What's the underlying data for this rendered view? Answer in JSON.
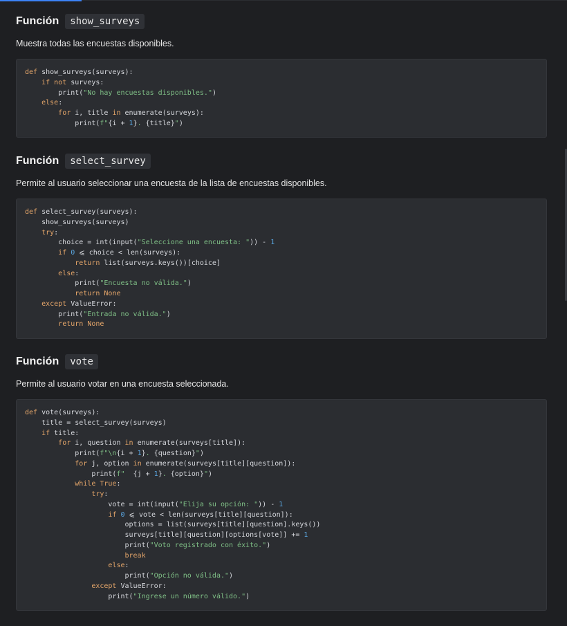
{
  "sections": [
    {
      "heading_prefix": "Función",
      "function_name": "show_surveys",
      "description": "Muestra todas las encuestas disponibles.",
      "code": [
        [
          [
            "def",
            "kw"
          ],
          [
            " show_surveys(surveys):",
            ""
          ]
        ],
        [
          [
            "    ",
            ""
          ],
          [
            "if not",
            "kw"
          ],
          [
            " surveys:",
            ""
          ]
        ],
        [
          [
            "        print(",
            ""
          ],
          [
            "\"No hay encuestas disponibles.\"",
            "str"
          ],
          [
            ")",
            ""
          ]
        ],
        [
          [
            "    ",
            ""
          ],
          [
            "else",
            "kw"
          ],
          [
            ":",
            ""
          ]
        ],
        [
          [
            "        ",
            ""
          ],
          [
            "for",
            "kw"
          ],
          [
            " i, title ",
            ""
          ],
          [
            "in",
            "kw"
          ],
          [
            " enumerate(surveys):",
            ""
          ]
        ],
        [
          [
            "            print(",
            ""
          ],
          [
            "f\"",
            "str"
          ],
          [
            "{i + ",
            ""
          ],
          [
            "1",
            "num"
          ],
          [
            "}",
            ""
          ],
          [
            ". ",
            "str"
          ],
          [
            "{title}",
            ""
          ],
          [
            "\"",
            "str"
          ],
          [
            ")",
            ""
          ]
        ]
      ]
    },
    {
      "heading_prefix": "Función",
      "function_name": "select_survey",
      "description": "Permite al usuario seleccionar una encuesta de la lista de encuestas disponibles.",
      "code": [
        [
          [
            "def",
            "kw"
          ],
          [
            " select_survey(surveys):",
            ""
          ]
        ],
        [
          [
            "    show_surveys(surveys)",
            ""
          ]
        ],
        [
          [
            "    ",
            ""
          ],
          [
            "try",
            "kw"
          ],
          [
            ":",
            ""
          ]
        ],
        [
          [
            "        choice = int(input(",
            ""
          ],
          [
            "\"Seleccione una encuesta: \"",
            "str"
          ],
          [
            ")) - ",
            ""
          ],
          [
            "1",
            "num"
          ]
        ],
        [
          [
            "        ",
            ""
          ],
          [
            "if",
            "kw"
          ],
          [
            " ",
            ""
          ],
          [
            "0",
            "num"
          ],
          [
            " ⩽ choice < len(surveys):",
            ""
          ]
        ],
        [
          [
            "            ",
            ""
          ],
          [
            "return",
            "kw"
          ],
          [
            " list(surveys.keys())[choice]",
            ""
          ]
        ],
        [
          [
            "        ",
            ""
          ],
          [
            "else",
            "kw"
          ],
          [
            ":",
            ""
          ]
        ],
        [
          [
            "            print(",
            ""
          ],
          [
            "\"Encuesta no válida.\"",
            "str"
          ],
          [
            ")",
            ""
          ]
        ],
        [
          [
            "            ",
            ""
          ],
          [
            "return None",
            "kw"
          ]
        ],
        [
          [
            "    ",
            ""
          ],
          [
            "except",
            "kw"
          ],
          [
            " ValueError:",
            ""
          ]
        ],
        [
          [
            "        print(",
            ""
          ],
          [
            "\"Entrada no válida.\"",
            "str"
          ],
          [
            ")",
            ""
          ]
        ],
        [
          [
            "        ",
            ""
          ],
          [
            "return None",
            "kw"
          ]
        ]
      ]
    },
    {
      "heading_prefix": "Función",
      "function_name": "vote",
      "description": "Permite al usuario votar en una encuesta seleccionada.",
      "code": [
        [
          [
            "def",
            "kw"
          ],
          [
            " vote(surveys):",
            ""
          ]
        ],
        [
          [
            "    title = select_survey(surveys)",
            ""
          ]
        ],
        [
          [
            "    ",
            ""
          ],
          [
            "if",
            "kw"
          ],
          [
            " title:",
            ""
          ]
        ],
        [
          [
            "        ",
            ""
          ],
          [
            "for",
            "kw"
          ],
          [
            " i, question ",
            ""
          ],
          [
            "in",
            "kw"
          ],
          [
            " enumerate(surveys[title]):",
            ""
          ]
        ],
        [
          [
            "            print(",
            ""
          ],
          [
            "f\"\\n",
            "str"
          ],
          [
            "{i + ",
            ""
          ],
          [
            "1",
            "num"
          ],
          [
            "}",
            ""
          ],
          [
            ". ",
            "str"
          ],
          [
            "{question}",
            ""
          ],
          [
            "\"",
            "str"
          ],
          [
            ")",
            ""
          ]
        ],
        [
          [
            "            ",
            ""
          ],
          [
            "for",
            "kw"
          ],
          [
            " j, option ",
            ""
          ],
          [
            "in",
            "kw"
          ],
          [
            " enumerate(surveys[title][question]):",
            ""
          ]
        ],
        [
          [
            "                print(",
            ""
          ],
          [
            "f\"  ",
            "str"
          ],
          [
            "{j + ",
            ""
          ],
          [
            "1",
            "num"
          ],
          [
            "}",
            ""
          ],
          [
            ". ",
            "str"
          ],
          [
            "{option}",
            ""
          ],
          [
            "\"",
            "str"
          ],
          [
            ")",
            ""
          ]
        ],
        [
          [
            "            ",
            ""
          ],
          [
            "while True",
            "kw"
          ],
          [
            ":",
            ""
          ]
        ],
        [
          [
            "                ",
            ""
          ],
          [
            "try",
            "kw"
          ],
          [
            ":",
            ""
          ]
        ],
        [
          [
            "                    vote = int(input(",
            ""
          ],
          [
            "\"Elija su opción: \"",
            "str"
          ],
          [
            ")) - ",
            ""
          ],
          [
            "1",
            "num"
          ]
        ],
        [
          [
            "                    ",
            ""
          ],
          [
            "if",
            "kw"
          ],
          [
            " ",
            ""
          ],
          [
            "0",
            "num"
          ],
          [
            " ⩽ vote < len(surveys[title][question]):",
            ""
          ]
        ],
        [
          [
            "                        options = list(surveys[title][question].keys())",
            ""
          ]
        ],
        [
          [
            "                        surveys[title][question][options[vote]] += ",
            ""
          ],
          [
            "1",
            "num"
          ]
        ],
        [
          [
            "                        print(",
            ""
          ],
          [
            "\"Voto registrado con éxito.\"",
            "str"
          ],
          [
            ")",
            ""
          ]
        ],
        [
          [
            "                        ",
            ""
          ],
          [
            "break",
            "kw"
          ]
        ],
        [
          [
            "                    ",
            ""
          ],
          [
            "else",
            "kw"
          ],
          [
            ":",
            ""
          ]
        ],
        [
          [
            "                        print(",
            ""
          ],
          [
            "\"Opción no válida.\"",
            "str"
          ],
          [
            ")",
            ""
          ]
        ],
        [
          [
            "                ",
            ""
          ],
          [
            "except",
            "kw"
          ],
          [
            " ValueError:",
            ""
          ]
        ],
        [
          [
            "                    print(",
            ""
          ],
          [
            "\"Ingrese un número válido.\"",
            "str"
          ],
          [
            ")",
            ""
          ]
        ]
      ]
    }
  ]
}
